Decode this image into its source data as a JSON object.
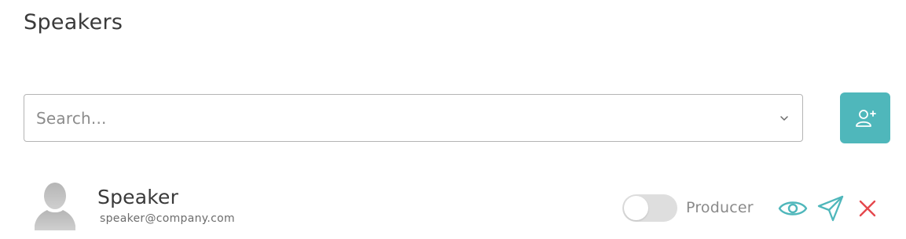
{
  "header": {
    "title": "Speakers"
  },
  "search": {
    "placeholder": "Search...",
    "dropdown_icon": "chevron-down-icon"
  },
  "add_button": {
    "icon": "add-user-icon",
    "color": "#4fb7bb"
  },
  "speakers": [
    {
      "name": "Speaker",
      "email": "speaker@company.com",
      "avatar_icon": "user-avatar-icon",
      "producer_toggle": {
        "label": "Producer",
        "on": false
      },
      "actions": [
        {
          "icon": "eye-icon",
          "color": "#4fb7bb"
        },
        {
          "icon": "send-icon",
          "color": "#4fb7bb"
        },
        {
          "icon": "close-icon",
          "color": "#e5484d"
        }
      ]
    }
  ]
}
